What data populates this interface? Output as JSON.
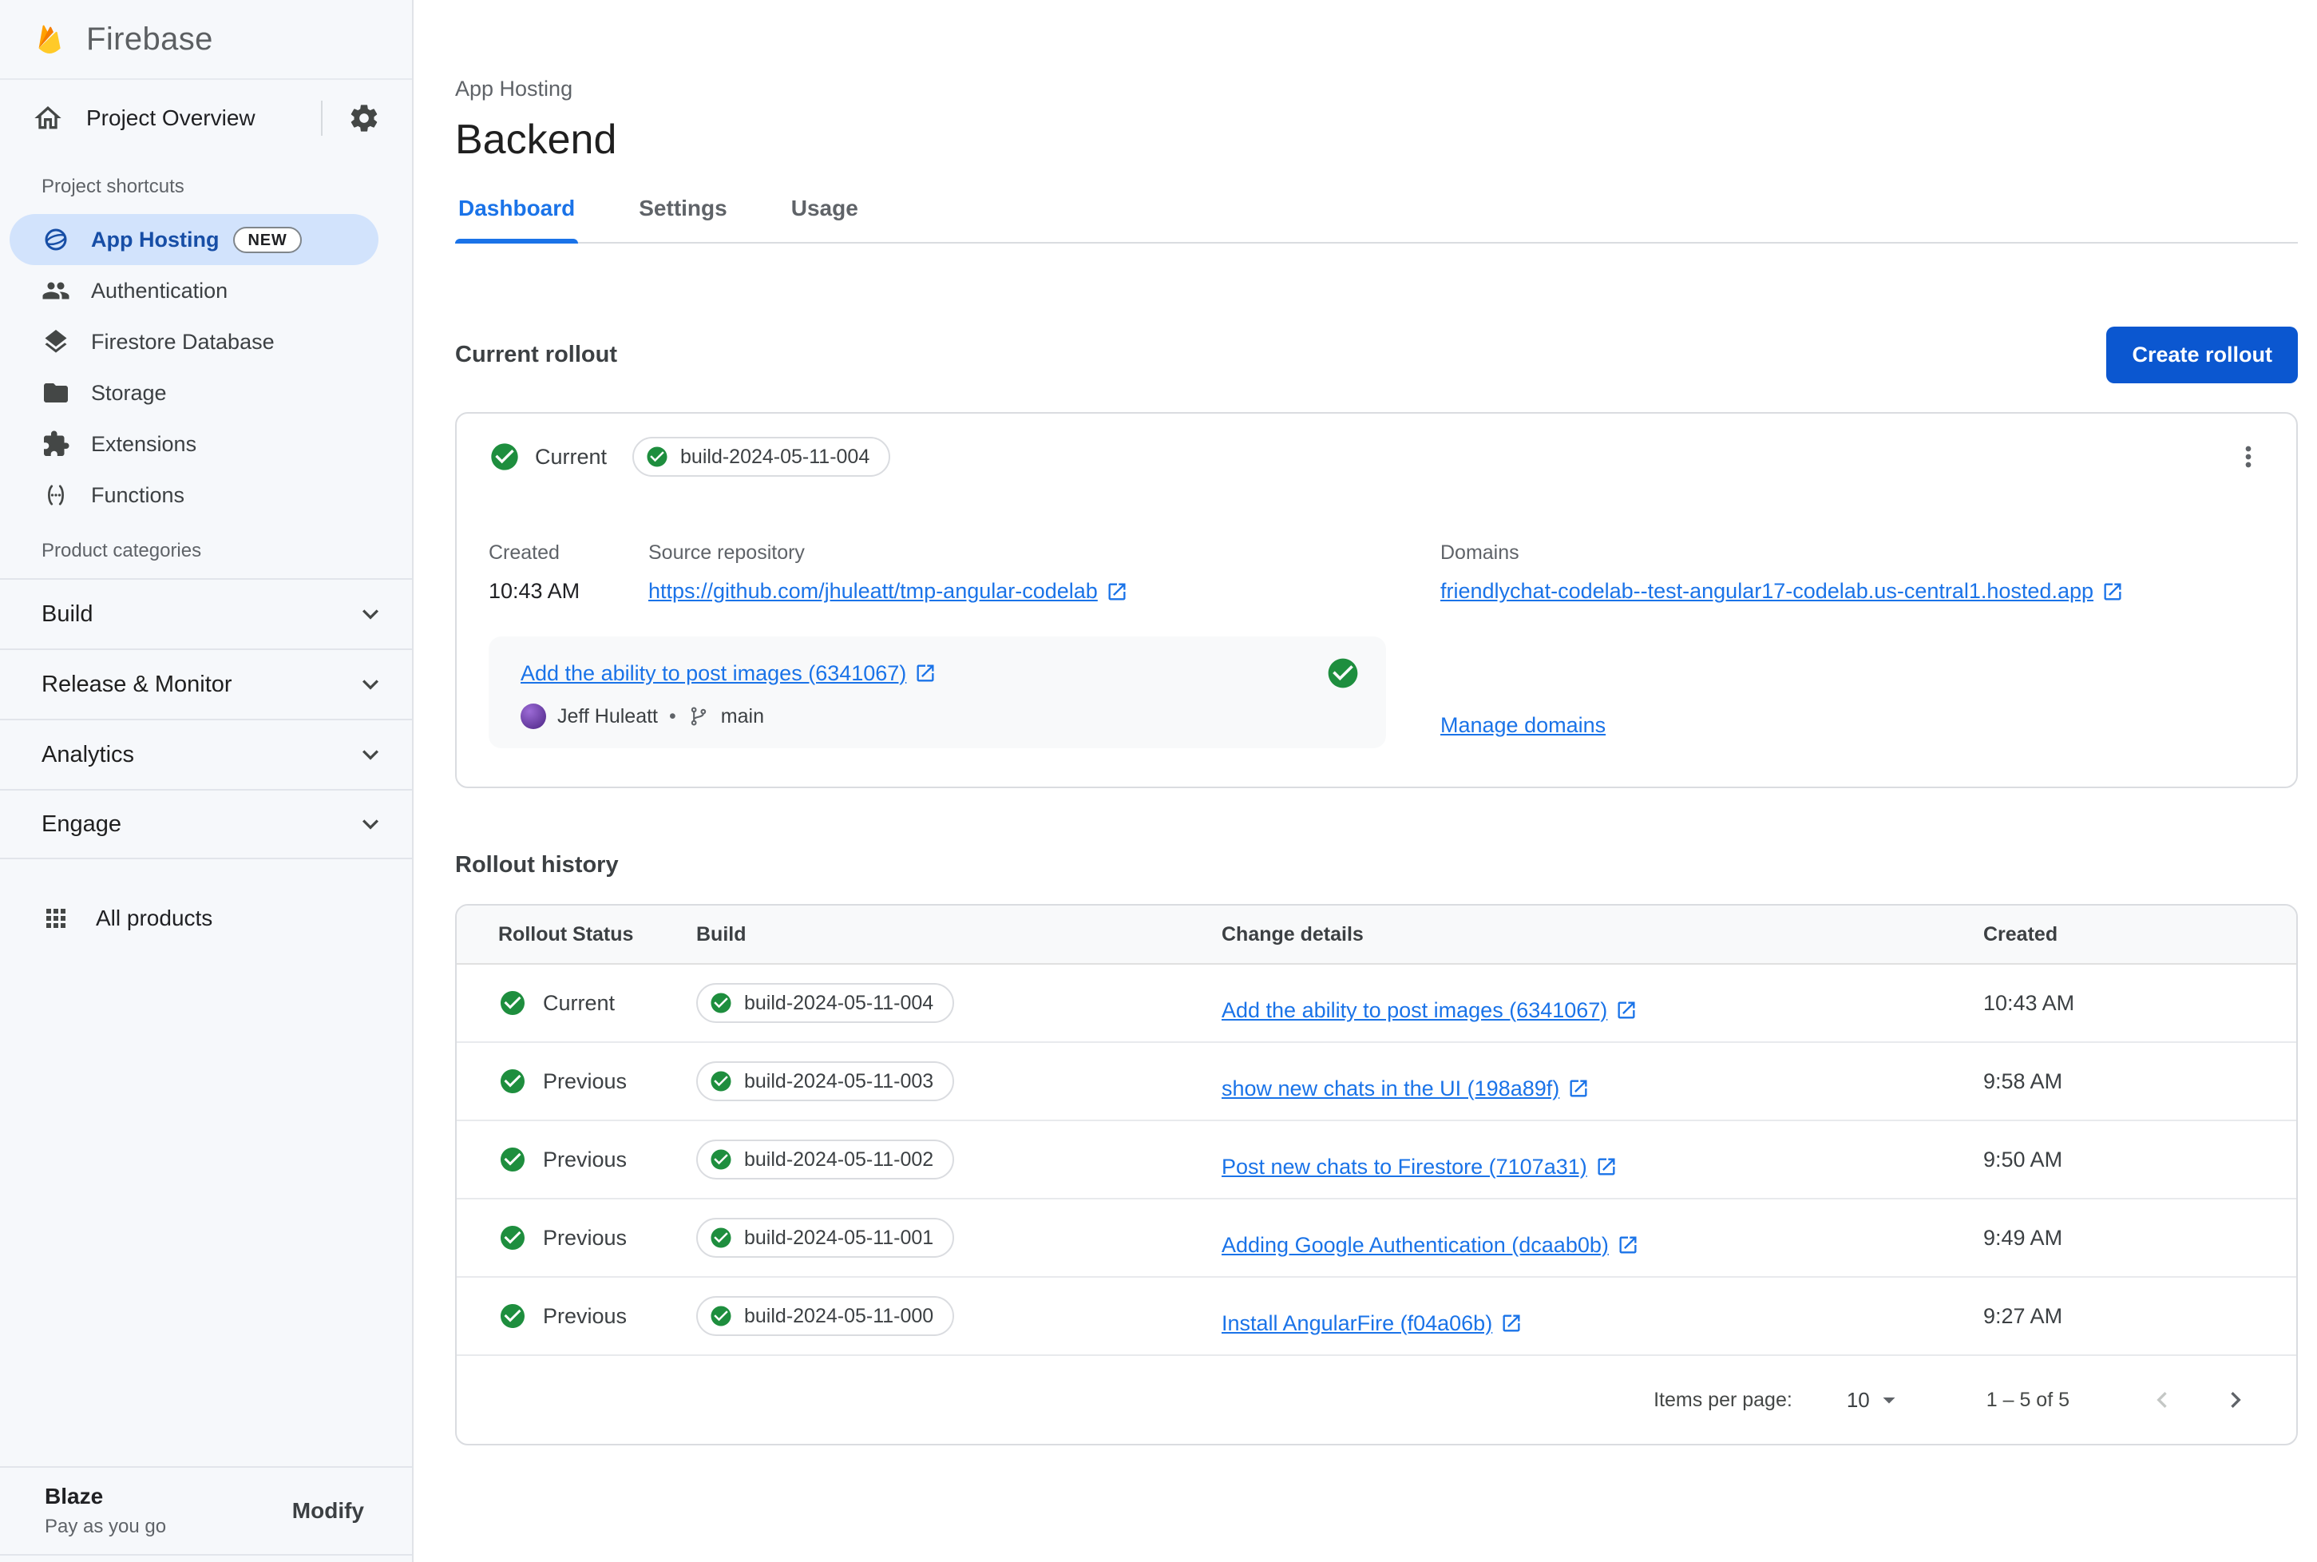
{
  "brand": {
    "name": "Firebase"
  },
  "sidebar": {
    "project_overview_label": "Project Overview",
    "shortcuts_label": "Project shortcuts",
    "categories_label": "Product categories",
    "shortcuts": [
      {
        "label": "App Hosting",
        "icon": "app-hosting-icon",
        "badge": "NEW",
        "selected": true
      },
      {
        "label": "Authentication",
        "icon": "authentication-icon"
      },
      {
        "label": "Firestore Database",
        "icon": "firestore-icon"
      },
      {
        "label": "Storage",
        "icon": "storage-icon"
      },
      {
        "label": "Extensions",
        "icon": "extensions-icon"
      },
      {
        "label": "Functions",
        "icon": "functions-icon"
      }
    ],
    "categories": [
      {
        "label": "Build"
      },
      {
        "label": "Release & Monitor"
      },
      {
        "label": "Analytics"
      },
      {
        "label": "Engage"
      }
    ],
    "all_products_label": "All products",
    "plan": {
      "name": "Blaze",
      "description": "Pay as you go",
      "action": "Modify"
    }
  },
  "header": {
    "eyebrow": "App Hosting",
    "title": "Backend",
    "tabs": [
      {
        "label": "Dashboard",
        "active": true
      },
      {
        "label": "Settings",
        "active": false
      },
      {
        "label": "Usage",
        "active": false
      }
    ]
  },
  "current_rollout": {
    "heading": "Current rollout",
    "create_button_label": "Create rollout",
    "status_label": "Current",
    "build_chip": "build-2024-05-11-004",
    "created_label": "Created",
    "created_value": "10:43 AM",
    "source_repository_label": "Source repository",
    "source_repository_link": "https://github.com/jhuleatt/tmp-angular-codelab",
    "domains_label": "Domains",
    "domain_link": "friendlychat-codelab--test-angular17-codelab.us-central1.hosted.app",
    "manage_domains_label": "Manage domains",
    "commit": {
      "title": "Add the ability to post images (6341067)",
      "author": "Jeff Huleatt",
      "separator": "•",
      "branch": "main"
    }
  },
  "rollout_history": {
    "heading": "Rollout history",
    "columns": [
      "Rollout Status",
      "Build",
      "Change details",
      "Created"
    ],
    "rows": [
      {
        "status": "Current",
        "build": "build-2024-05-11-004",
        "change": "Add the ability to post images (6341067)",
        "created": "10:43 AM"
      },
      {
        "status": "Previous",
        "build": "build-2024-05-11-003",
        "change": "show new chats in the UI (198a89f)",
        "created": "9:58 AM"
      },
      {
        "status": "Previous",
        "build": "build-2024-05-11-002",
        "change": "Post new chats to Firestore (7107a31)",
        "created": "9:50 AM"
      },
      {
        "status": "Previous",
        "build": "build-2024-05-11-001",
        "change": "Adding Google Authentication (dcaab0b)",
        "created": "9:49 AM"
      },
      {
        "status": "Previous",
        "build": "build-2024-05-11-000",
        "change": "Install AngularFire (f04a06b)",
        "created": "9:27 AM"
      }
    ],
    "pagination": {
      "items_per_page_label": "Items per page:",
      "items_per_page_value": "10",
      "range": "1 – 5 of 5"
    }
  },
  "colors": {
    "primary_blue": "#0b57d0",
    "link_blue": "#1a73e8",
    "success_green": "#1e8e3e",
    "selected_item_bg": "#d2e3fc",
    "selected_item_text": "#174ea6",
    "sidebar_bg": "#f6f8fb"
  }
}
